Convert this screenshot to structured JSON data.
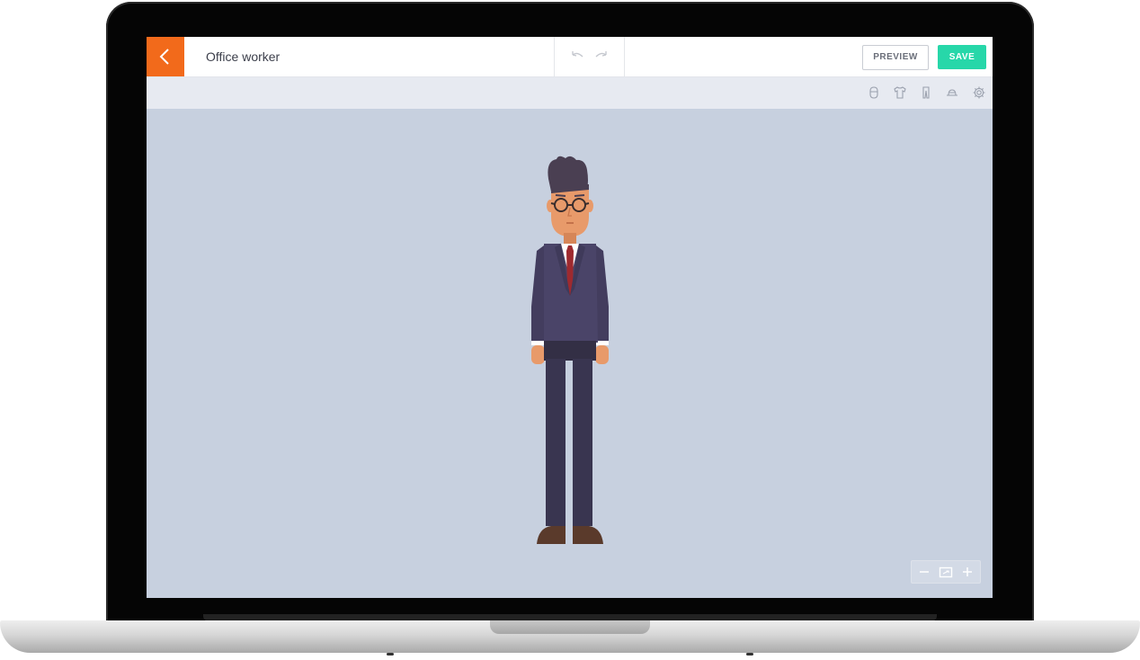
{
  "app": {
    "document_title": "Office worker"
  },
  "topbar": {
    "back_icon": "chevron-left-icon",
    "undo_icon": "undo-icon",
    "redo_icon": "redo-icon",
    "preview_label": "PREVIEW",
    "save_label": "SAVE"
  },
  "toolbar": {
    "icons": [
      "head-icon",
      "shirt-icon",
      "pants-icon",
      "hat-icon",
      "gear-icon"
    ]
  },
  "zoom": {
    "out_icon": "minus-icon",
    "fit_icon": "fit-screen-icon",
    "in_icon": "plus-icon"
  },
  "colors": {
    "accent_orange": "#f26a1b",
    "save_green": "#27d7a9",
    "canvas_bg": "#c7d0df",
    "suit": "#4a4468",
    "tie": "#9e2a2f",
    "skin": "#e89a6a",
    "hair": "#4a3f52",
    "shoes": "#5a3a2b"
  }
}
